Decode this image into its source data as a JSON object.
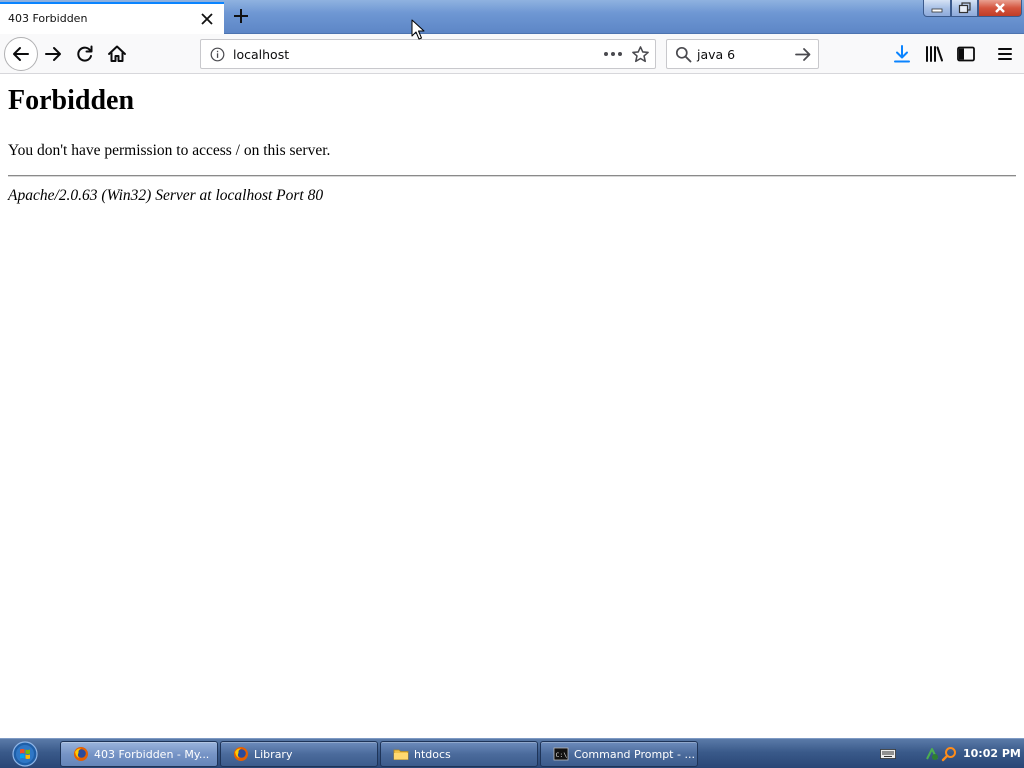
{
  "browser": {
    "tab": {
      "title": "403 Forbidden"
    },
    "url": "localhost",
    "search_query": "java 6"
  },
  "page": {
    "heading": "Forbidden",
    "message": "You don't have permission to access / on this server.",
    "address": "Apache/2.0.63 (Win32) Server at localhost Port 80"
  },
  "taskbar": {
    "tasks": [
      {
        "label": "403 Forbidden - My...",
        "icon": "firefox-icon",
        "active": true
      },
      {
        "label": "Library",
        "icon": "firefox-icon",
        "active": false
      },
      {
        "label": "htdocs",
        "icon": "folder-icon",
        "active": false
      },
      {
        "label": "Command Prompt - ...",
        "icon": "cmd-icon",
        "active": false
      }
    ],
    "clock": "10:02 PM"
  },
  "colors": {
    "tab_accent": "#0a84ff",
    "download_icon": "#0a84ff",
    "taskbar": "#3a5a8a",
    "title_bar": "#6e97d3"
  }
}
